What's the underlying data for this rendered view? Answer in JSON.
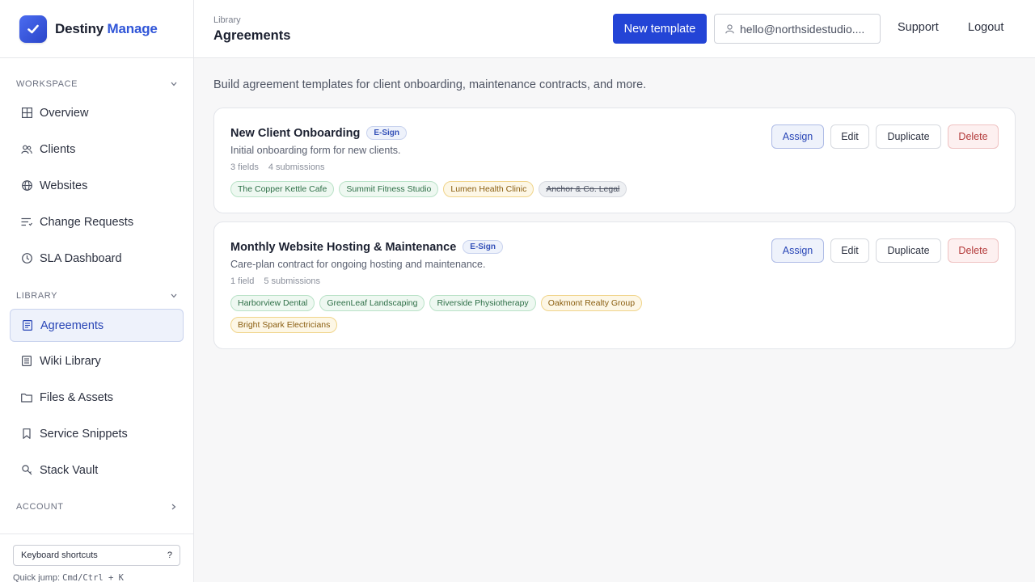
{
  "brand": {
    "name_part1": "Destiny",
    "name_part2": "Manage"
  },
  "sidebar": {
    "workspace_label": "Workspace",
    "workspace_items": [
      {
        "label": "Overview",
        "icon": "grid-icon"
      },
      {
        "label": "Clients",
        "icon": "users-icon"
      },
      {
        "label": "Websites",
        "icon": "globe-icon"
      },
      {
        "label": "Change Requests",
        "icon": "list-icon"
      },
      {
        "label": "SLA Dashboard",
        "icon": "clock-icon"
      }
    ],
    "library_label": "Library",
    "library_items": [
      {
        "label": "Agreements",
        "icon": "document-icon",
        "active": true
      },
      {
        "label": "Wiki Library",
        "icon": "book-icon"
      },
      {
        "label": "Files & Assets",
        "icon": "folder-icon"
      },
      {
        "label": "Service Snippets",
        "icon": "bookmark-icon"
      },
      {
        "label": "Stack Vault",
        "icon": "key-icon"
      }
    ],
    "account_label": "Account",
    "keyboard_shortcuts": "Keyboard shortcuts",
    "keyboard_shortcuts_key": "?",
    "quick_jump_label": "Quick jump:",
    "quick_jump_keys": "Cmd/Ctrl + K"
  },
  "header": {
    "breadcrumb": "Library",
    "title": "Agreements",
    "new_template": "New template",
    "user_email": "hello@northsidestudio....",
    "support": "Support",
    "logout": "Logout"
  },
  "main": {
    "intro": "Build agreement templates for client onboarding, maintenance contracts, and more.",
    "templates": [
      {
        "title": "New Client Onboarding",
        "badge": "E-Sign",
        "description": "Initial onboarding form for new clients.",
        "fields": "3 fields",
        "submissions": "4 submissions",
        "clients": [
          {
            "name": "The Copper Kettle Cafe",
            "status": "green"
          },
          {
            "name": "Summit Fitness Studio",
            "status": "green"
          },
          {
            "name": "Lumen Health Clinic",
            "status": "amber"
          },
          {
            "name": "Anchor & Co. Legal",
            "status": "gray"
          }
        ]
      },
      {
        "title": "Monthly Website Hosting & Maintenance",
        "badge": "E-Sign",
        "description": "Care-plan contract for ongoing hosting and maintenance.",
        "fields": "1 field",
        "submissions": "5 submissions",
        "clients": [
          {
            "name": "Harborview Dental",
            "status": "green"
          },
          {
            "name": "GreenLeaf Landscaping",
            "status": "green"
          },
          {
            "name": "Riverside Physiotherapy",
            "status": "green"
          },
          {
            "name": "Oakmont Realty Group",
            "status": "amber"
          },
          {
            "name": "Bright Spark Electricians",
            "status": "amber"
          }
        ]
      }
    ],
    "actions": {
      "assign": "Assign",
      "edit": "Edit",
      "duplicate": "Duplicate",
      "delete": "Delete"
    }
  },
  "colors": {
    "accent": "#2344d6",
    "active_bg": "#eef2fb",
    "delete": "#b33a3a"
  }
}
